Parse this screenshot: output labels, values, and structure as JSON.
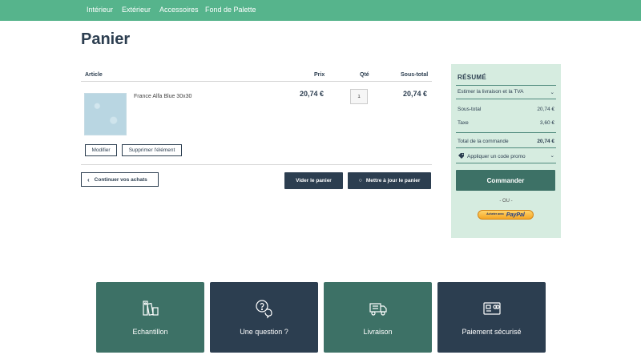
{
  "nav": {
    "items": [
      {
        "label": "Intérieur"
      },
      {
        "label": "Extérieur"
      },
      {
        "label": "Accessoires"
      },
      {
        "label": "Fond de Palette"
      }
    ]
  },
  "page": {
    "title": "Panier"
  },
  "cart": {
    "headers": {
      "article": "Article",
      "price": "Prix",
      "qty": "Qté",
      "subtotal": "Sous-total"
    },
    "item": {
      "name": "France Alfa Blue 30x30",
      "price": "20,74 €",
      "qty": "1",
      "subtotal": "20,74 €",
      "edit_label": "Modifier",
      "delete_label": "Supprimer l'élément"
    },
    "actions": {
      "continue_label": "Continuer vos achats",
      "empty_label": "Vider le panier",
      "update_label": "Mettre à jour le panier"
    }
  },
  "summary": {
    "title": "RÉSUMÉ",
    "estimate_label": "Estimer la livraison et la TVA",
    "subtotal_label": "Sous-total",
    "subtotal_value": "20,74 €",
    "tax_label": "Taxe",
    "tax_value": "3,60 €",
    "total_label": "Total de la commande",
    "total_value": "20,74 €",
    "promo_label": "Appliquer un code promo",
    "checkout_label": "Commander",
    "or_label": "- OU -",
    "paypal_small": "Acheter avec",
    "paypal_logo": "PayPal"
  },
  "features": [
    {
      "label": "Echantillon",
      "icon": "swatch-icon"
    },
    {
      "label": "Une question ?",
      "icon": "question-chat-icon"
    },
    {
      "label": "Livraison",
      "icon": "truck-icon"
    },
    {
      "label": "Paiement sécurisé",
      "icon": "card-payment-icon"
    }
  ],
  "colors": {
    "nav_green": "#56b48c",
    "navy": "#2c3e50",
    "teal": "#3d7166",
    "summary_bg": "#d6ece0"
  }
}
